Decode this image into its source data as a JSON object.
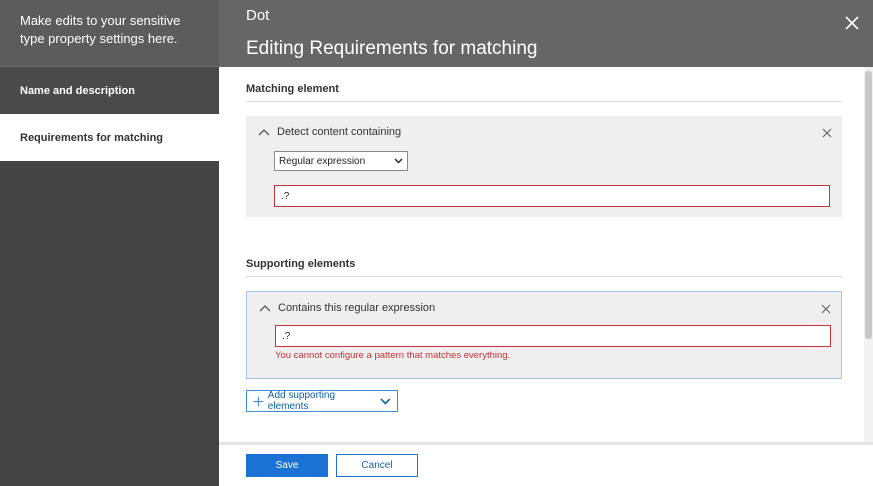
{
  "sidebar": {
    "intro": "Make edits to your sensitive type property settings here.",
    "items": [
      {
        "label": "Name and description"
      },
      {
        "label": "Requirements for matching"
      }
    ]
  },
  "header": {
    "subtitle": "Dot",
    "title": "Editing Requirements for matching"
  },
  "matching": {
    "section_title": "Matching element",
    "card_title": "Detect content containing",
    "select_value": "Regular expression",
    "input_value": ".?"
  },
  "supporting": {
    "section_title": "Supporting elements",
    "card_title": "Contains this regular expression",
    "input_value": ".?",
    "error": "You cannot configure a pattern that matches everything.",
    "add_label": "Add supporting elements"
  },
  "footer": {
    "save_label": "Save",
    "cancel_label": "Cancel"
  },
  "icons": {
    "close": "close-icon",
    "chevron_up": "chevron-up-icon",
    "chevron_down": "chevron-down-icon",
    "plus": "plus-icon"
  },
  "colors": {
    "accent": "#1a73d4",
    "error": "#c2353a",
    "sidebar_bg": "#444444",
    "header_bg": "#666666"
  }
}
